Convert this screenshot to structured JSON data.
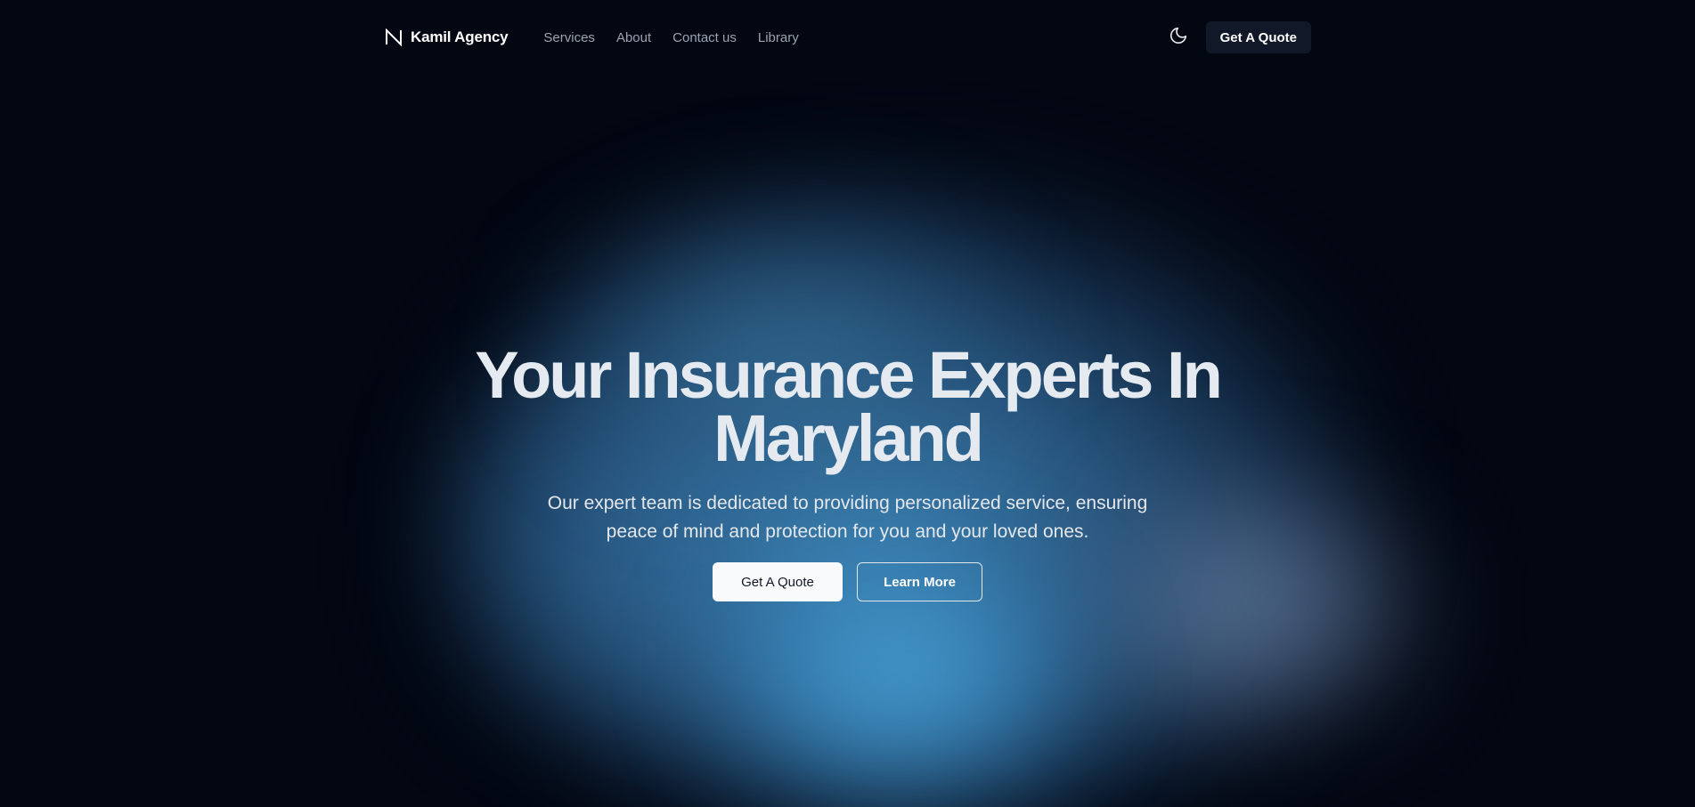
{
  "brand": {
    "name": "Kamil Agency",
    "logo_icon": "m-logo-icon"
  },
  "nav": {
    "links": [
      "Services",
      "About",
      "Contact us",
      "Library"
    ],
    "theme_toggle_icon": "moon-icon",
    "cta_label": "Get A Quote"
  },
  "hero": {
    "title": "Your Insurance Experts In Maryland",
    "subtitle": "Our expert team is dedicated to providing personalized service, ensuring peace of mind and protection for you and your loved ones.",
    "primary_label": "Get A Quote",
    "secondary_label": "Learn More"
  },
  "colors": {
    "background": "#030712",
    "nav_button_bg": "#111827",
    "glow_blue": "#3b9bd2",
    "glow_grey": "#6e87aa"
  }
}
